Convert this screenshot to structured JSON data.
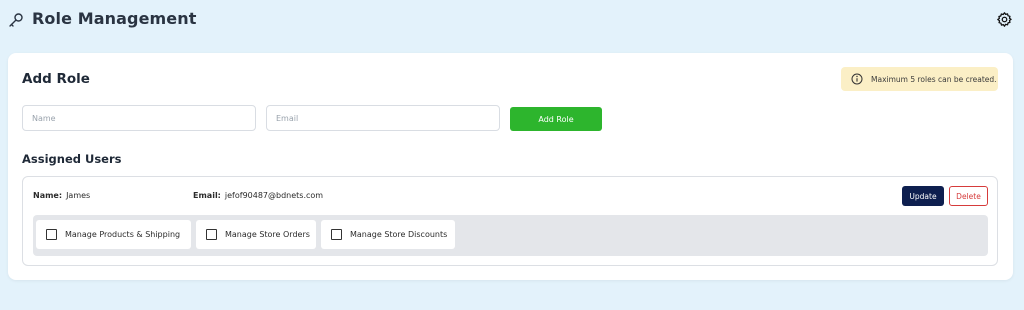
{
  "header": {
    "title": "Role Management",
    "left_icon": "key-icon",
    "right_icon": "gear-icon"
  },
  "add_role": {
    "title": "Add Role",
    "notice": "Maximum 5 roles can be created.",
    "name_placeholder": "Name",
    "email_placeholder": "Email",
    "submit_label": "Add Role"
  },
  "assigned": {
    "title": "Assigned Users",
    "users": [
      {
        "name_label": "Name:",
        "name": "James",
        "email_label": "Email:",
        "email": "jefof90487@bdnets.com",
        "update_label": "Update",
        "delete_label": "Delete",
        "permissions": [
          {
            "label": "Manage Products & Shipping",
            "checked": false
          },
          {
            "label": "Manage Store Orders",
            "checked": false
          },
          {
            "label": "Manage Store Discounts",
            "checked": false
          }
        ]
      }
    ]
  },
  "colors": {
    "background": "#e3f2fb",
    "add_button": "#2db52d",
    "update_button": "#0e1f4f",
    "delete_button": "#d63b3b",
    "notice_background": "#fbefc6"
  }
}
